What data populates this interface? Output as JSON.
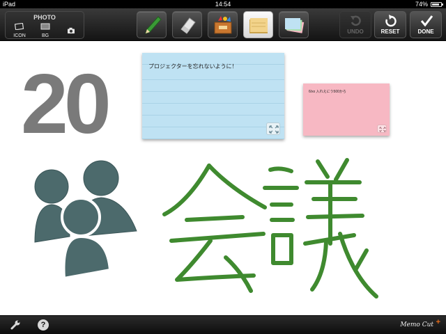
{
  "status_bar": {
    "carrier": "iPad",
    "time": "14:54",
    "battery": "74%"
  },
  "toolbar": {
    "photo_group": {
      "title": "PHOTO",
      "icon_label": "ICON",
      "bg_label": "BG"
    },
    "tools": [
      "pencil-icon",
      "eraser-icon",
      "stamp-box-icon",
      "memo-pad-icon",
      "memo-stack-icon"
    ],
    "undo_label": "UNDO",
    "reset_label": "RESET",
    "done_label": "DONE"
  },
  "canvas": {
    "big_number": "20",
    "memo_blue": {
      "text": "プロジェクターを忘れないように！",
      "color": "#bfe2f3"
    },
    "memo_pink": {
      "text": "6/xx 入れえにう500から",
      "color": "#f7b8c3"
    },
    "handwriting_text": "会議",
    "handwriting_color": "#3f8a2f",
    "people_color": "#4c6a6c"
  },
  "bottom_bar": {
    "brand": "Memo Cut",
    "brand_plus": "+",
    "help_label": "?"
  }
}
